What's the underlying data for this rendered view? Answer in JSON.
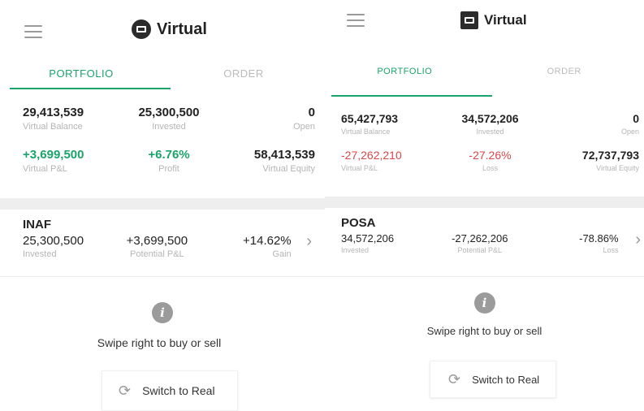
{
  "screens": [
    {
      "brand": {
        "title": "Virtual",
        "icon": "shield-icon"
      },
      "tabs": [
        {
          "label": "PORTFOLIO",
          "active": true
        },
        {
          "label": "ORDER",
          "active": false
        }
      ],
      "stats": [
        {
          "value": "29,413,539",
          "label": "Virtual Balance"
        },
        {
          "value": "25,300,500",
          "label": "Invested"
        },
        {
          "value": "0",
          "label": "Open"
        },
        {
          "value": "+3,699,500",
          "label": "Virtual P&L"
        },
        {
          "value": "+6.76%",
          "label": "Profit"
        },
        {
          "value": "58,413,539",
          "label": "Virtual Equity"
        }
      ],
      "position": {
        "symbol": "INAF",
        "invested_value": "25,300,500",
        "invested_label": "Invested",
        "pnl_value": "+3,699,500",
        "pnl_label": "Potential P&L",
        "pct_value": "+14.62%",
        "pct_label": "Gain"
      },
      "hint": "Swipe right to buy or sell",
      "switch_label": "Switch to Real"
    },
    {
      "brand": {
        "title": "Virtual",
        "icon": "card-icon"
      },
      "tabs": [
        {
          "label": "PORTFOLIO",
          "active": true
        },
        {
          "label": "ORDER",
          "active": false
        }
      ],
      "stats": [
        {
          "value": "65,427,793",
          "label": "Virtual Balance"
        },
        {
          "value": "34,572,206",
          "label": "Invested"
        },
        {
          "value": "0",
          "label": "Open"
        },
        {
          "value": "-27,262,210",
          "label": "Virtual P&L"
        },
        {
          "value": "-27.26%",
          "label": "Loss"
        },
        {
          "value": "72,737,793",
          "label": "Virtual Equity"
        }
      ],
      "position": {
        "symbol": "POSA",
        "invested_value": "34,572,206",
        "invested_label": "Invested",
        "pnl_value": "-27,262,206",
        "pnl_label": "Potential P&L",
        "pct_value": "-78.86%",
        "pct_label": "Loss"
      },
      "hint": "Swipe right to buy or sell",
      "switch_label": "Switch to Real"
    }
  ],
  "colors": {
    "accent": "#1aa36a",
    "negative": "#d9474a",
    "muted": "#b5b5b5"
  }
}
